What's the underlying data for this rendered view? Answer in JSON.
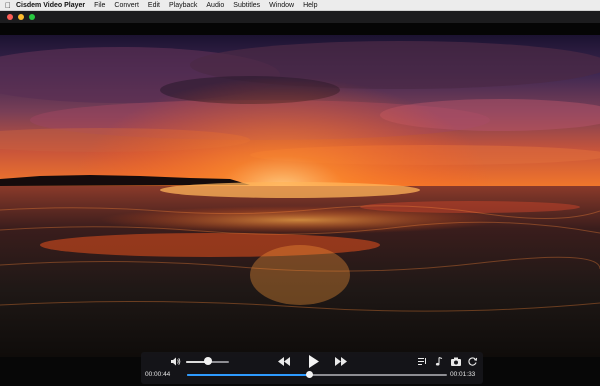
{
  "menubar": {
    "app_name": "Cisdem Video Player",
    "items": [
      "File",
      "Convert",
      "Edit",
      "Playback",
      "Audio",
      "Subtitles",
      "Window",
      "Help"
    ]
  },
  "controls": {
    "elapsed": "00:00:44",
    "total": "00:01:33",
    "progress": 0.47,
    "volume": 0.5,
    "accent_color": "#2e9bff"
  },
  "icons": [
    "apple-icon",
    "volume-icon",
    "rewind-icon",
    "play-icon",
    "fast-forward-icon",
    "playlist-icon",
    "music-note-icon",
    "camera-icon",
    "rotate-icon"
  ]
}
